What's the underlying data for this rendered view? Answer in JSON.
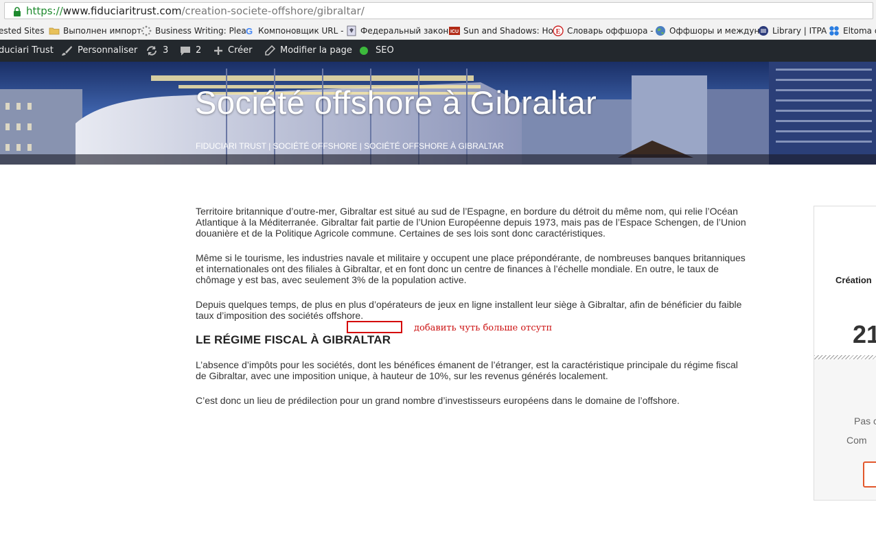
{
  "browser": {
    "url": {
      "protocol": "https://",
      "host": "www.fiduciaritrust.com",
      "path": "/creation-societe-offshore/gibraltar/"
    },
    "bookmarks": [
      {
        "label": "ested Sites",
        "icon": "none"
      },
      {
        "label": "Выполнен импорт",
        "icon": "folder-icon"
      },
      {
        "label": "Business Writing: Plea",
        "icon": "gear-dots-icon"
      },
      {
        "label": "Компоновщик URL -",
        "icon": "google-icon"
      },
      {
        "label": "Федеральный закон",
        "icon": "doc-eagle-icon"
      },
      {
        "label": "Sun and Shadows: Ho",
        "icon": "icu-icon"
      },
      {
        "label": "Словарь оффшора -",
        "icon": "offshore-logo-icon"
      },
      {
        "label": "Оффшоры и междун",
        "icon": "globe-icon"
      },
      {
        "label": "Library | ITPA",
        "icon": "library-icon"
      },
      {
        "label": "Eltoma d",
        "icon": "eltoma-icon"
      }
    ]
  },
  "adminbar": {
    "site": "duciari Trust",
    "customize": "Personnaliser",
    "updates": "3",
    "comments": "2",
    "new": "Créer",
    "edit": "Modifier la page",
    "seo": "SEO"
  },
  "hero": {
    "title": "Société offshore à Gibraltar",
    "breadcrumb": "FIDUCIARI TRUST | SOCIÉTÉ OFFSHORE | SOCIÉTÉ OFFSHORE À GIBRALTAR"
  },
  "content": {
    "p1": "Territoire britannique d’outre-mer, Gibraltar est situé au sud de l’Espagne, en bordure du détroit du même nom, qui relie l’Océan Atlantique à la Méditerranée. Gibraltar fait partie de l’Union Européenne depuis 1973, mais pas de l’Espace Schengen, de l’Union douanière et de la Politique Agricole commune. Certaines de ses lois sont donc caractéristiques.",
    "p2": "Même si le tourisme, les industries navale et militaire y occupent une place prépondérante, de nombreuses banques britanniques et internationales ont des filiales à Gibraltar, et en font donc un centre de finances à l’échelle mondiale. En outre, le taux de chômage y est bas, avec seulement 3% de la population active.",
    "p3": "Depuis quelques temps, de plus en plus d’opérateurs de jeux en ligne installent leur siège à Gibraltar, afin de bénéficier du faible taux d’imposition des sociétés offshore.",
    "heading": "LE RÉGIME FISCAL À GIBRALTAR",
    "p4": "L’absence d’impôts pour les sociétés, dont les bénéfices émanent de l’étranger, est la caractéristique principale du régime fiscal de Gibraltar, avec une imposition unique, à hauteur de 10%, sur les revenus générés localement.",
    "p5": "C’est donc un lieu de prédilection pour un grand nombre d’investisseurs européens dans le domaine de l’offshore."
  },
  "annotation": {
    "text": "добавить чуть больше отсутп",
    "color": "#d40000"
  },
  "widget": {
    "title": "Création",
    "price": "21",
    "line1": "Pas c",
    "line2": "Com"
  },
  "colors": {
    "adminbar": "#23282d",
    "seo_dot": "#3cb93c",
    "url_green": "#1e8a2e",
    "accent_orange": "#e2572b"
  }
}
